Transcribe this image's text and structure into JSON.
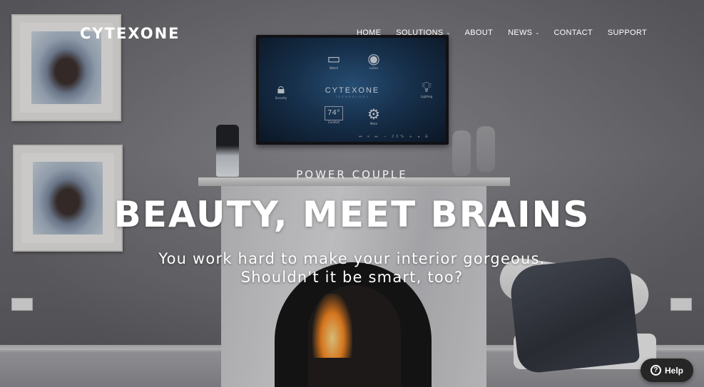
{
  "brand": {
    "logo_text": "CYTEXONE"
  },
  "nav": {
    "items": [
      {
        "label": "HOME",
        "has_dropdown": false
      },
      {
        "label": "SOLUTIONS",
        "has_dropdown": true
      },
      {
        "label": "ABOUT",
        "has_dropdown": false
      },
      {
        "label": "NEWS",
        "has_dropdown": true
      },
      {
        "label": "CONTACT",
        "has_dropdown": false
      },
      {
        "label": "SUPPORT",
        "has_dropdown": false
      }
    ],
    "dropdown_icon": "chevron-down-icon"
  },
  "tv_screen": {
    "logo": "CYTEXONE",
    "logo_sub": "TECHNOLOGY",
    "tiles": [
      {
        "label": "Watch",
        "icon": "tv-icon"
      },
      {
        "label": "Listen",
        "icon": "music-icon"
      },
      {
        "label": "Security",
        "icon": "lock-icon"
      },
      {
        "label": "Lighting",
        "icon": "lightbulb-icon"
      },
      {
        "label": "Comfort",
        "icon": "thermostat-icon"
      },
      {
        "label": "More",
        "icon": "gear-icon"
      }
    ],
    "thermostat_value": "74°",
    "volume_level": "20%"
  },
  "hero": {
    "eyebrow": "POWER COUPLE",
    "headline": "BEAUTY, MEET BRAINS",
    "subline_1": "You work hard to make your interior gorgeous.",
    "subline_2": "Shouldn't it be smart, too?"
  },
  "help_button": {
    "label": "Help",
    "icon": "question-circle-icon"
  }
}
